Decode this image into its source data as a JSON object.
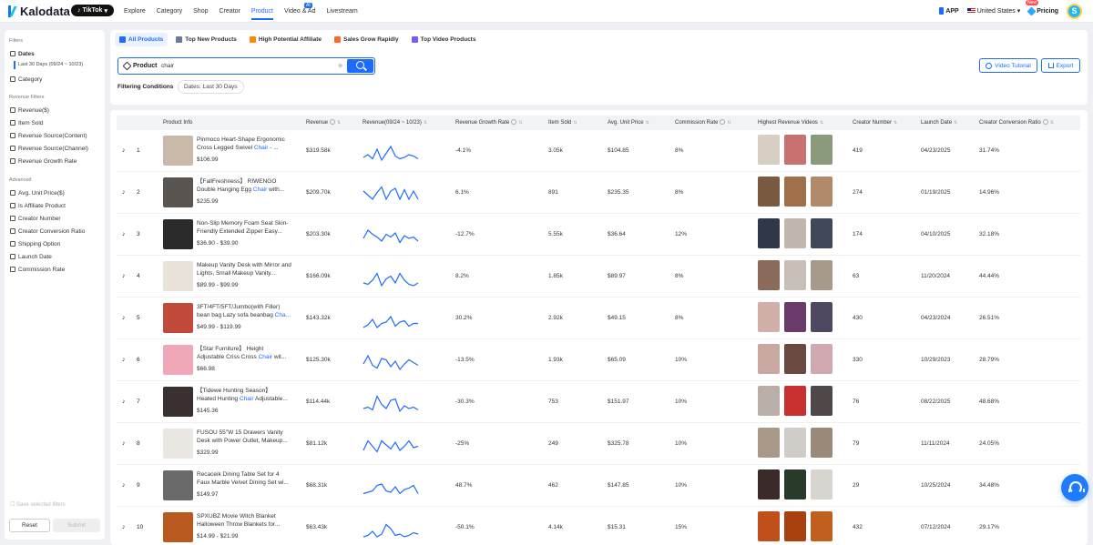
{
  "nav": {
    "brand": "Kalodata",
    "platform": "TikTok",
    "links": [
      "Explore",
      "Category",
      "Shop",
      "Creator",
      "Product",
      "Video & Ad",
      "Livestream"
    ],
    "active_link": "Product",
    "ai_badge": "AI",
    "app_label": "APP",
    "region": "United States",
    "new_badge": "New",
    "pricing": "Pricing",
    "avatar_letter": "S"
  },
  "sidebar": {
    "filters_heading": "Filters",
    "dates_label": "Dates",
    "dates_value": "Last 30 Days (09/24 ~ 10/23)",
    "category_label": "Category",
    "revenue_heading": "Revenue Filters",
    "revenue_items": [
      "Revenue($)",
      "Item Sold",
      "Revenue Source(Content)",
      "Revenue Source(Channel)",
      "Revenue Growth Rate"
    ],
    "advanced_heading": "Advanced",
    "advanced_items": [
      "Avg. Unit Price($)",
      "Is Affiliate Product",
      "Creator Number",
      "Creator Conversion Ratio",
      "Shipping Option",
      "Launch Date",
      "Commission Rate"
    ],
    "save_label": "Save selected filters",
    "reset_label": "Reset",
    "submit_label": "Submit"
  },
  "tabs": [
    "All Products",
    "Top New Products",
    "High Potential Affiliate",
    "Sales Grow Rapidly",
    "Top Video Products"
  ],
  "search": {
    "label": "Product",
    "value": "chair",
    "clear": "⊗"
  },
  "filtering": {
    "label": "Filtering Conditions",
    "chip": "Dates: Last 30 Days"
  },
  "buttons": {
    "video_tutorial": "Video Tutorial",
    "export": "Export"
  },
  "table": {
    "headers": [
      "Product Info",
      "Revenue",
      "Revenue(09/24 ~ 10/23)",
      "Revenue Growth Rate",
      "Item Sold",
      "Avg. Unit Price",
      "Commission Rate",
      "Highest Revenue Videos",
      "Creator Number",
      "Launch Date",
      "Creator Conversion Ratio"
    ],
    "rows": [
      {
        "rank": "1",
        "name_pre": "Pinmoco Heart-Shape Ergonomic Cross Legged Swivel ",
        "name_hl": "Chair",
        "name_post": " - ...",
        "price": "$106.99",
        "revenue": "$319.58k",
        "growth": "-4.1%",
        "sold": "3.05k",
        "avg": "$104.85",
        "commission": "8%",
        "creators": "419",
        "launch": "04/23/2025",
        "ratio": "31.74%"
      },
      {
        "rank": "2",
        "name_pre": "【FallFreshness】 RIWENGO Double Hanging Egg ",
        "name_hl": "Chair",
        "name_post": " with...",
        "price": "$235.99",
        "revenue": "$209.70k",
        "growth": "6.1%",
        "sold": "891",
        "avg": "$235.35",
        "commission": "8%",
        "creators": "274",
        "launch": "01/19/2025",
        "ratio": "14.96%"
      },
      {
        "rank": "3",
        "name_pre": "Non-Slip Memory Foam Seat Skin-Friendly Extended Zipper Easy...",
        "name_hl": "",
        "name_post": "",
        "price": "$36.90 - $39.90",
        "revenue": "$203.30k",
        "growth": "-12.7%",
        "sold": "5.55k",
        "avg": "$36.64",
        "commission": "12%",
        "creators": "174",
        "launch": "04/10/2025",
        "ratio": "32.18%"
      },
      {
        "rank": "4",
        "name_pre": "Makeup Vanity Desk with Mirror and Lights, Small Makeup Vanity...",
        "name_hl": "",
        "name_post": "",
        "price": "$89.99 - $99.99",
        "revenue": "$166.09k",
        "growth": "8.2%",
        "sold": "1.85k",
        "avg": "$89.97",
        "commission": "8%",
        "creators": "63",
        "launch": "11/20/2024",
        "ratio": "44.44%"
      },
      {
        "rank": "5",
        "name_pre": "3FT/4FT/5FT/Jumbo(with Filler) bean bag Lazy sofa beanbag ",
        "name_hl": "Cha...",
        "name_post": "",
        "price": "$49.99 - $119.99",
        "revenue": "$143.32k",
        "growth": "30.2%",
        "sold": "2.92k",
        "avg": "$49.15",
        "commission": "8%",
        "creators": "430",
        "launch": "04/23/2024",
        "ratio": "26.51%"
      },
      {
        "rank": "6",
        "name_pre": "【Star Furniture】 Height Adjustable Criss Cross ",
        "name_hl": "Chair",
        "name_post": " wit...",
        "price": "$66.98",
        "revenue": "$125.30k",
        "growth": "-13.5%",
        "sold": "1.93k",
        "avg": "$65.09",
        "commission": "10%",
        "creators": "330",
        "launch": "10/29/2023",
        "ratio": "28.79%"
      },
      {
        "rank": "7",
        "name_pre": "【Tidewe Hunting Season】 Heated Hunting ",
        "name_hl": "Chair",
        "name_post": " Adjustable...",
        "price": "$145.36",
        "revenue": "$114.44k",
        "growth": "-30.3%",
        "sold": "753",
        "avg": "$151.97",
        "commission": "10%",
        "creators": "76",
        "launch": "08/22/2025",
        "ratio": "48.68%"
      },
      {
        "rank": "8",
        "name_pre": "FUSOU 55\"W 15 Drawers Vanity Desk with Power Outlet, Makeup...",
        "name_hl": "",
        "name_post": "",
        "price": "$329.99",
        "revenue": "$81.12k",
        "growth": "-25%",
        "sold": "249",
        "avg": "$325.78",
        "commission": "10%",
        "creators": "79",
        "launch": "11/11/2024",
        "ratio": "24.05%"
      },
      {
        "rank": "9",
        "name_pre": "Recaceik Dining Table Set for 4 Faux Marble Velvet Dining Set wi...",
        "name_hl": "",
        "name_post": "",
        "price": "$149.97",
        "revenue": "$68.31k",
        "growth": "48.7%",
        "sold": "462",
        "avg": "$147.85",
        "commission": "10%",
        "creators": "29",
        "launch": "10/25/2024",
        "ratio": "34.48%"
      },
      {
        "rank": "10",
        "name_pre": "SPXUBZ Movie Witch Blanket Halloween Throw Blankets for...",
        "name_hl": "",
        "name_post": "",
        "price": "$14.99 - $21.99",
        "revenue": "$63.43k",
        "growth": "-50.1%",
        "sold": "4.14k",
        "avg": "$15.31",
        "commission": "15%",
        "creators": "432",
        "launch": "07/12/2024",
        "ratio": "29.17%"
      }
    ],
    "thumb_colors": [
      "#c9b9a8",
      "#5a5550",
      "#2b2b2b",
      "#e8e2d8",
      "#c24a3a",
      "#f0a8b8",
      "#3a3030",
      "#eae6e2",
      "#6a6a6a",
      "#b85a20"
    ],
    "video_colors": [
      [
        "#d8cfc4",
        "#c97070",
        "#8a9a7a"
      ],
      [
        "#7a5a40",
        "#a0704a",
        "#b08a6a"
      ],
      [
        "#303848",
        "#c0b8b0",
        "#404858"
      ],
      [
        "#8a6a5a",
        "#c8c0b8",
        "#a89a8a"
      ],
      [
        "#d0b0a8",
        "#6a3a6a",
        "#504860"
      ],
      [
        "#c8a8a0",
        "#6a4a40",
        "#d0a8b0"
      ],
      [
        "#b8b0a8",
        "#c83030",
        "#504848"
      ],
      [
        "#a89888",
        "#d0ccc8",
        "#9a8a7a"
      ],
      [
        "#3a2a2a",
        "#2a3a2a",
        "#d8d4d0"
      ],
      [
        "#c0501a",
        "#a84010",
        "#c06020"
      ]
    ],
    "sparklines": [
      [
        12,
        10,
        13,
        6,
        14,
        9,
        4,
        11,
        13,
        12,
        10,
        11,
        13
      ],
      [
        6,
        9,
        12,
        7,
        3,
        12,
        6,
        4,
        12,
        5,
        12,
        6,
        12
      ],
      [
        10,
        4,
        7,
        9,
        12,
        7,
        9,
        6,
        13,
        8,
        10,
        9,
        12
      ],
      [
        12,
        13,
        10,
        5,
        14,
        9,
        7,
        12,
        5,
        10,
        13,
        14,
        12
      ],
      [
        14,
        12,
        8,
        14,
        11,
        10,
        6,
        13,
        10,
        9,
        13,
        11,
        11
      ],
      [
        10,
        4,
        11,
        13,
        6,
        7,
        12,
        8,
        14,
        10,
        7,
        9,
        11
      ],
      [
        12,
        11,
        13,
        3,
        9,
        12,
        6,
        5,
        14,
        10,
        12,
        11,
        13
      ],
      [
        12,
        5,
        9,
        13,
        5,
        8,
        11,
        6,
        12,
        9,
        5,
        10,
        9
      ],
      [
        13,
        12,
        11,
        7,
        6,
        11,
        12,
        8,
        13,
        10,
        9,
        7,
        13
      ],
      [
        14,
        13,
        10,
        14,
        12,
        5,
        8,
        13,
        12,
        14,
        13,
        11,
        12
      ]
    ]
  }
}
